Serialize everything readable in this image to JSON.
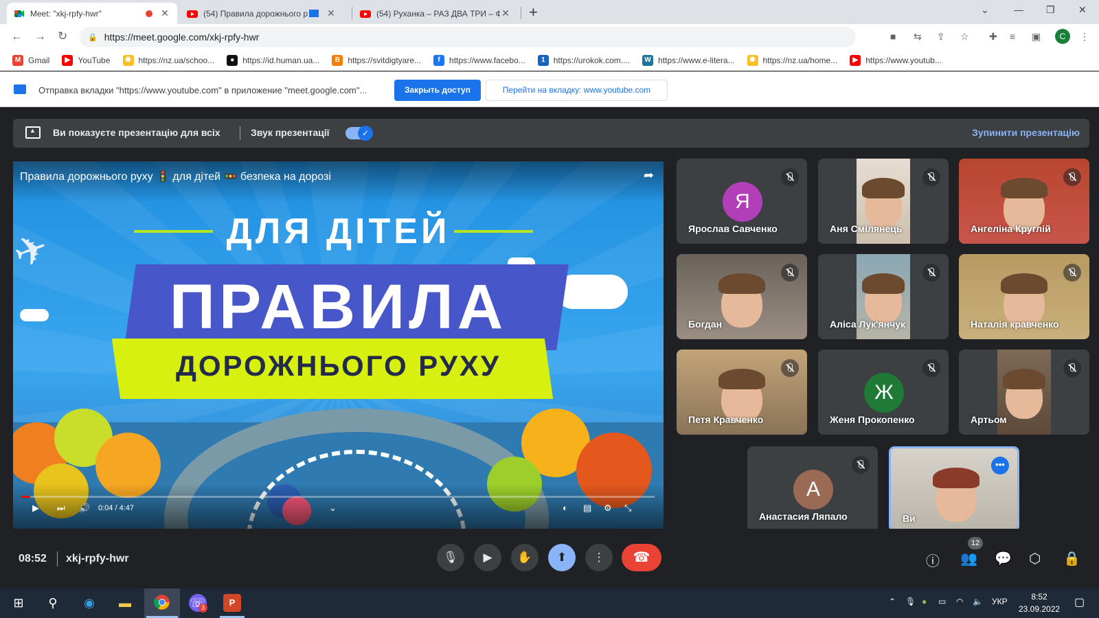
{
  "browser": {
    "tabs": [
      {
        "title": "Meet: \"xkj-rpfy-hwr\"",
        "icon": "meet-icon",
        "active": true
      },
      {
        "title": "(54) Правила дорожнього р",
        "icon": "youtube-icon",
        "active": false
      },
      {
        "title": "(54) Руханка – РАЗ ДВА ТРИ – Ф",
        "icon": "youtube-icon",
        "active": false
      }
    ],
    "new_tab": "+",
    "url": "https://meet.google.com/xkj-rpfy-hwr",
    "profile_initial": "C"
  },
  "bookmarks": [
    {
      "label": "Gmail",
      "icon": "gmail-icon",
      "color": "#ea4335",
      "glyph": "M"
    },
    {
      "label": "YouTube",
      "icon": "youtube-icon",
      "color": "#ff0000",
      "glyph": "▶"
    },
    {
      "label": "https://nz.ua/schoo...",
      "icon": "sun-icon",
      "color": "#f6c026",
      "glyph": "✺"
    },
    {
      "label": "https://id.human.ua...",
      "icon": "human-icon",
      "color": "#111111",
      "glyph": "●"
    },
    {
      "label": "https://svitdigtyare...",
      "icon": "blogger-icon",
      "color": "#f57d00",
      "glyph": "B"
    },
    {
      "label": "https://www.facebo...",
      "icon": "facebook-icon",
      "color": "#1877f2",
      "glyph": "f"
    },
    {
      "label": "https://urokok.com....",
      "icon": "urok-icon",
      "color": "#1565c0",
      "glyph": "1"
    },
    {
      "label": "https://www.e-litera...",
      "icon": "wordpress-icon",
      "color": "#21759b",
      "glyph": "W"
    },
    {
      "label": "https://nz.ua/home...",
      "icon": "sun-icon",
      "color": "#f6c026",
      "glyph": "✺"
    },
    {
      "label": "https://www.youtub...",
      "icon": "youtube-icon",
      "color": "#ff0000",
      "glyph": "▶"
    }
  ],
  "infobar": {
    "text": "Отправка вкладки \"https://www.youtube.com\" в приложение \"meet.google.com\"...",
    "stop_button": "Закрыть доступ",
    "switch_button": "Перейти на вкладку: www.youtube.com"
  },
  "presenting": {
    "message": "Ви показуєте презентацію для всіх",
    "audio_label": "Звук презентації",
    "audio_on": true,
    "stop_link": "Зупинити презентацію"
  },
  "video": {
    "title": "Правила дорожнього руху 🚦 для дітей 🚥 безпека на дорозі",
    "line1": "ДЛЯ ДІТЕЙ",
    "line2": "ПРАВИЛА",
    "line3": "ДОРОЖНЬОГО РУХУ",
    "time": "0:04 / 4:47",
    "progress_fraction": 0.014
  },
  "participants": [
    {
      "name": "Ярослав Савченко",
      "initial": "Я",
      "avatar_color": "#b33fb8",
      "video": false
    },
    {
      "name": "Аня Смілянець",
      "video": true,
      "bg": "#cdbfae",
      "strip": "#e6ddd2"
    },
    {
      "name": "Ангеліна Круглій",
      "video": true,
      "bg": "#c8554a",
      "strip": "#b8462f"
    },
    {
      "name": "Богдан",
      "video": true,
      "bg": "#9b8f83",
      "strip": "#6a625b"
    },
    {
      "name": "Аліса Лук'янчук",
      "video": true,
      "bg": "#b8b4a8",
      "strip": "#8aa7b4"
    },
    {
      "name": "Наталія кравченко",
      "video": true,
      "bg": "#c9b07c",
      "strip": "#b89a62"
    },
    {
      "name": "Петя Кравченко",
      "video": true,
      "bg": "#8a7358",
      "strip": "#c2a478"
    },
    {
      "name": "Женя Прокопенко",
      "initial": "Ж",
      "avatar_color": "#1e7a35",
      "video": false
    },
    {
      "name": "Артьом",
      "video": true,
      "bg": "#5d4a3a",
      "strip": "#7c6a57"
    },
    {
      "name": "Анастасия Ляпало",
      "initial": "А",
      "avatar_color": "#9b6a55",
      "video": false
    },
    {
      "name": "Ви",
      "video": true,
      "bg": "#b9b4a9",
      "strip": "#d7d3ca",
      "self": true
    }
  ],
  "bottom": {
    "time": "08:52",
    "meeting_code": "xkj-rpfy-hwr",
    "participants_count": "12"
  },
  "taskbar": {
    "language": "УКР",
    "time": "8:52",
    "date": "23.09.2022",
    "viber_badge": "3"
  }
}
